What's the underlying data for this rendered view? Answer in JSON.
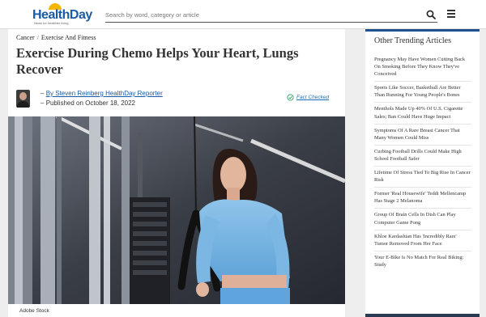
{
  "header": {
    "logo_part1": "Health",
    "logo_part2": "Day",
    "logo_tagline": "News for healthier living",
    "search_placeholder": "Search by word, category or article"
  },
  "article": {
    "breadcrumbs": [
      "Cancer",
      "Exercise And Fitness"
    ],
    "breadcrumb_sep": "/",
    "title": "Exercise During Chemo Helps Your Heart, Lungs Recover",
    "author_line": "By Steven Reinberg HealthDay Reporter",
    "published_line": "Published on October 18, 2022",
    "byline_dash": "–",
    "fact_check": "Fact Checked",
    "image_credit": "Adobe Stock"
  },
  "sidebar": {
    "title": "Other Trending Articles",
    "items": [
      "Pregnancy May Have Women Cutting Back On Smoking Before They Know They've Conceived",
      "Sports Like Soccer, Basketball Are Better Than Running For Young People's Bones",
      "Menthols Made Up 40% Of U.S. Cigarette Sales; Ban Could Have Huge Impact",
      "Symptoms Of A Rare Breast Cancer That Many Women Could Miss",
      "Curbing Football Drills Could Make High School Football Safer",
      "Lifetime Of Stress Tied To Big Rise In Cancer Risk",
      "Former 'Real Housewife' Teddi Mellencamp Has Stage 2 Melanoma",
      "Group Of Brain Cells In Dish Can Play Computer Game Pong",
      "Khloe Kardashian Has 'Incredibly Rare' Tumor Removed From Her Face",
      "Your E-Bike Is No Match For Real Biking: Study"
    ]
  },
  "colors": {
    "brand_blue": "#1a5aa6",
    "accent_yellow": "#f5b400",
    "sidebar_border": "#1e4f8e",
    "link_blue": "#1a6fb8"
  },
  "icons": {
    "search": "search-icon",
    "menu": "menu-icon",
    "fact_check": "check-circle-icon"
  }
}
